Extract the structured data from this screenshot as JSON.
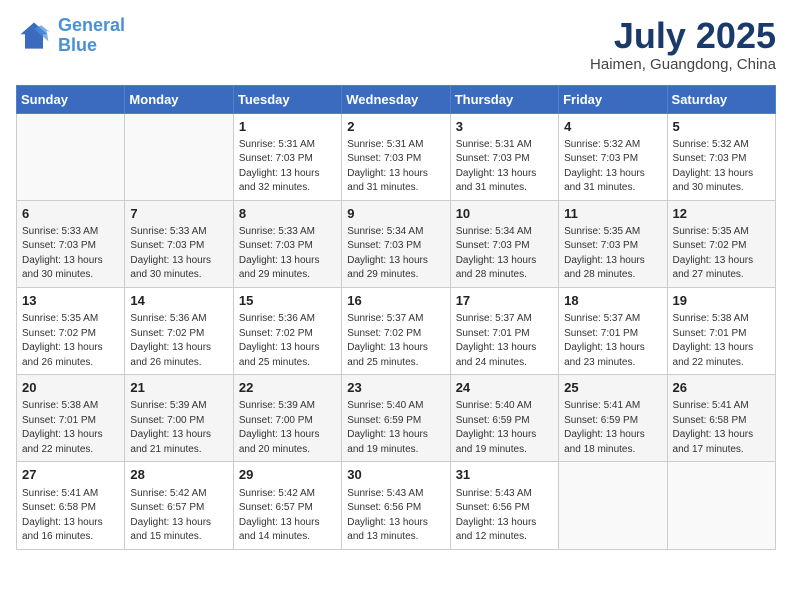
{
  "header": {
    "logo_line1": "General",
    "logo_line2": "Blue",
    "month_year": "July 2025",
    "location": "Haimen, Guangdong, China"
  },
  "days_of_week": [
    "Sunday",
    "Monday",
    "Tuesday",
    "Wednesday",
    "Thursday",
    "Friday",
    "Saturday"
  ],
  "weeks": [
    [
      {
        "day": "",
        "text": ""
      },
      {
        "day": "",
        "text": ""
      },
      {
        "day": "1",
        "text": "Sunrise: 5:31 AM\nSunset: 7:03 PM\nDaylight: 13 hours and 32 minutes."
      },
      {
        "day": "2",
        "text": "Sunrise: 5:31 AM\nSunset: 7:03 PM\nDaylight: 13 hours and 31 minutes."
      },
      {
        "day": "3",
        "text": "Sunrise: 5:31 AM\nSunset: 7:03 PM\nDaylight: 13 hours and 31 minutes."
      },
      {
        "day": "4",
        "text": "Sunrise: 5:32 AM\nSunset: 7:03 PM\nDaylight: 13 hours and 31 minutes."
      },
      {
        "day": "5",
        "text": "Sunrise: 5:32 AM\nSunset: 7:03 PM\nDaylight: 13 hours and 30 minutes."
      }
    ],
    [
      {
        "day": "6",
        "text": "Sunrise: 5:33 AM\nSunset: 7:03 PM\nDaylight: 13 hours and 30 minutes."
      },
      {
        "day": "7",
        "text": "Sunrise: 5:33 AM\nSunset: 7:03 PM\nDaylight: 13 hours and 30 minutes."
      },
      {
        "day": "8",
        "text": "Sunrise: 5:33 AM\nSunset: 7:03 PM\nDaylight: 13 hours and 29 minutes."
      },
      {
        "day": "9",
        "text": "Sunrise: 5:34 AM\nSunset: 7:03 PM\nDaylight: 13 hours and 29 minutes."
      },
      {
        "day": "10",
        "text": "Sunrise: 5:34 AM\nSunset: 7:03 PM\nDaylight: 13 hours and 28 minutes."
      },
      {
        "day": "11",
        "text": "Sunrise: 5:35 AM\nSunset: 7:03 PM\nDaylight: 13 hours and 28 minutes."
      },
      {
        "day": "12",
        "text": "Sunrise: 5:35 AM\nSunset: 7:02 PM\nDaylight: 13 hours and 27 minutes."
      }
    ],
    [
      {
        "day": "13",
        "text": "Sunrise: 5:35 AM\nSunset: 7:02 PM\nDaylight: 13 hours and 26 minutes."
      },
      {
        "day": "14",
        "text": "Sunrise: 5:36 AM\nSunset: 7:02 PM\nDaylight: 13 hours and 26 minutes."
      },
      {
        "day": "15",
        "text": "Sunrise: 5:36 AM\nSunset: 7:02 PM\nDaylight: 13 hours and 25 minutes."
      },
      {
        "day": "16",
        "text": "Sunrise: 5:37 AM\nSunset: 7:02 PM\nDaylight: 13 hours and 25 minutes."
      },
      {
        "day": "17",
        "text": "Sunrise: 5:37 AM\nSunset: 7:01 PM\nDaylight: 13 hours and 24 minutes."
      },
      {
        "day": "18",
        "text": "Sunrise: 5:37 AM\nSunset: 7:01 PM\nDaylight: 13 hours and 23 minutes."
      },
      {
        "day": "19",
        "text": "Sunrise: 5:38 AM\nSunset: 7:01 PM\nDaylight: 13 hours and 22 minutes."
      }
    ],
    [
      {
        "day": "20",
        "text": "Sunrise: 5:38 AM\nSunset: 7:01 PM\nDaylight: 13 hours and 22 minutes."
      },
      {
        "day": "21",
        "text": "Sunrise: 5:39 AM\nSunset: 7:00 PM\nDaylight: 13 hours and 21 minutes."
      },
      {
        "day": "22",
        "text": "Sunrise: 5:39 AM\nSunset: 7:00 PM\nDaylight: 13 hours and 20 minutes."
      },
      {
        "day": "23",
        "text": "Sunrise: 5:40 AM\nSunset: 6:59 PM\nDaylight: 13 hours and 19 minutes."
      },
      {
        "day": "24",
        "text": "Sunrise: 5:40 AM\nSunset: 6:59 PM\nDaylight: 13 hours and 19 minutes."
      },
      {
        "day": "25",
        "text": "Sunrise: 5:41 AM\nSunset: 6:59 PM\nDaylight: 13 hours and 18 minutes."
      },
      {
        "day": "26",
        "text": "Sunrise: 5:41 AM\nSunset: 6:58 PM\nDaylight: 13 hours and 17 minutes."
      }
    ],
    [
      {
        "day": "27",
        "text": "Sunrise: 5:41 AM\nSunset: 6:58 PM\nDaylight: 13 hours and 16 minutes."
      },
      {
        "day": "28",
        "text": "Sunrise: 5:42 AM\nSunset: 6:57 PM\nDaylight: 13 hours and 15 minutes."
      },
      {
        "day": "29",
        "text": "Sunrise: 5:42 AM\nSunset: 6:57 PM\nDaylight: 13 hours and 14 minutes."
      },
      {
        "day": "30",
        "text": "Sunrise: 5:43 AM\nSunset: 6:56 PM\nDaylight: 13 hours and 13 minutes."
      },
      {
        "day": "31",
        "text": "Sunrise: 5:43 AM\nSunset: 6:56 PM\nDaylight: 13 hours and 12 minutes."
      },
      {
        "day": "",
        "text": ""
      },
      {
        "day": "",
        "text": ""
      }
    ]
  ]
}
